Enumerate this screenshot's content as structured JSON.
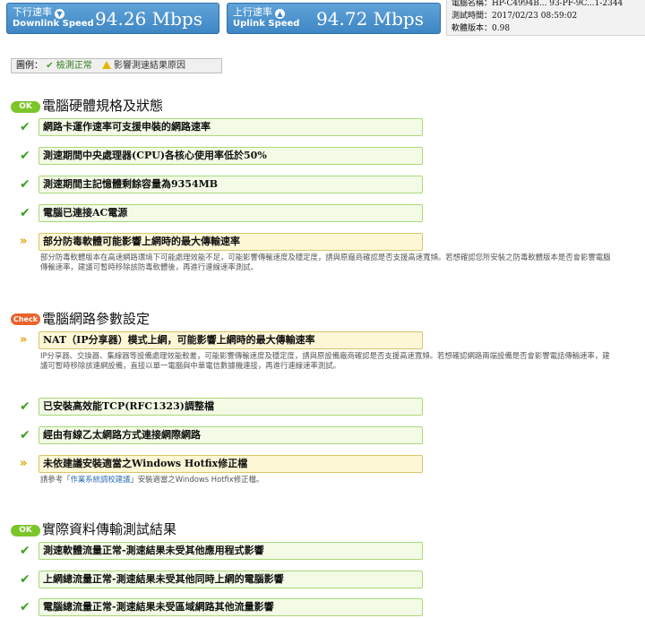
{
  "speed": {
    "down": {
      "label_zh": "下行速率",
      "label_en": "Downlink Speed",
      "value": "94.26 Mbps",
      "icon": "arrow-down-circle-icon"
    },
    "up": {
      "label_zh": "上行速率",
      "label_en": "Uplink Speed",
      "value": "94.72 Mbps",
      "icon": "arrow-up-circle-icon"
    }
  },
  "info": {
    "line0": "電腦名稱：HP-C4994B... 93-PF-9C...1-2344",
    "time_label": "測試時間：",
    "time_value": "2017/02/23 08:59:02",
    "version_label": "軟體版本：",
    "version_value": "0.98"
  },
  "legend": {
    "prefix": "圖例：",
    "ok_label": "檢測正常",
    "warn_label": "影響測速結果原因"
  },
  "colors": {
    "ok": "#7cc52a",
    "check": "#e9642b",
    "warn": "#e0a100",
    "speed_panel": "#3f86c4"
  },
  "sections": [
    {
      "badge": "OK",
      "title": "電腦硬體規格及狀態",
      "items": [
        {
          "status": "ok",
          "text": "網路卡運作速率可支援申裝的網路速率"
        },
        {
          "status": "ok",
          "text": "測速期間中央處理器(CPU)各核心使用率低於50%"
        },
        {
          "status": "ok",
          "text": "測速期間主記憶體剩餘容量為9354MB"
        },
        {
          "status": "ok",
          "text": "電腦已連接AC電源"
        },
        {
          "status": "warn",
          "text": "部分防毒軟體可能影響上網時的最大傳輸速率",
          "desc": "部分防毒軟體版本在高速網路環境下可能處理效能不足，可能影響傳輸速度及穩定度，請與原廠商確認是否支援高速寬頻。若想確認您所安裝之防毒軟體版本是否會影響電腦傳輸速率，建議可暫時移除該防毒軟體後，再進行連線速率測試。"
        }
      ]
    },
    {
      "badge": "Check",
      "title": "電腦網路參數設定",
      "items": [
        {
          "status": "warn",
          "text": "NAT（IP分享器）模式上網，可能影響上網時的最大傳輸速率",
          "desc": "IP分享器、交換器、集線器等設備處理效能較差，可能影響傳輸速度及穩定度，請與原設備廠商確認是否支援高速寬頻。若想確認網路兩端設備是否會影響電話傳輸速率，建議可暫時移除該連網設備，直接以單一電腦與中華電信數據機連接，再進行連線速率測試。"
        },
        {
          "status": "ok",
          "text": "已安裝高效能TCP(RFC1323)調整檔"
        },
        {
          "status": "ok",
          "text": "經由有線乙太網路方式連接網際網路"
        },
        {
          "status": "warn",
          "text": "未依建議安裝適當之Windows Hotfix修正檔",
          "desc_pre": "請參考「",
          "desc_link": "作業系統調校建議",
          "desc_post": "」安裝適當之Windows Hotfix修正檔。"
        }
      ]
    },
    {
      "badge": "OK",
      "title": "實際資料傳輸測試結果",
      "items": [
        {
          "status": "ok",
          "text": "測速軟體流量正常-測速結果未受其他應用程式影響"
        },
        {
          "status": "ok",
          "text": "上網總流量正常-測速結果未受其他同時上網的電腦影響"
        },
        {
          "status": "ok",
          "text": "電腦總流量正常-測速結果未受區域網路其他流量影響"
        }
      ]
    }
  ]
}
